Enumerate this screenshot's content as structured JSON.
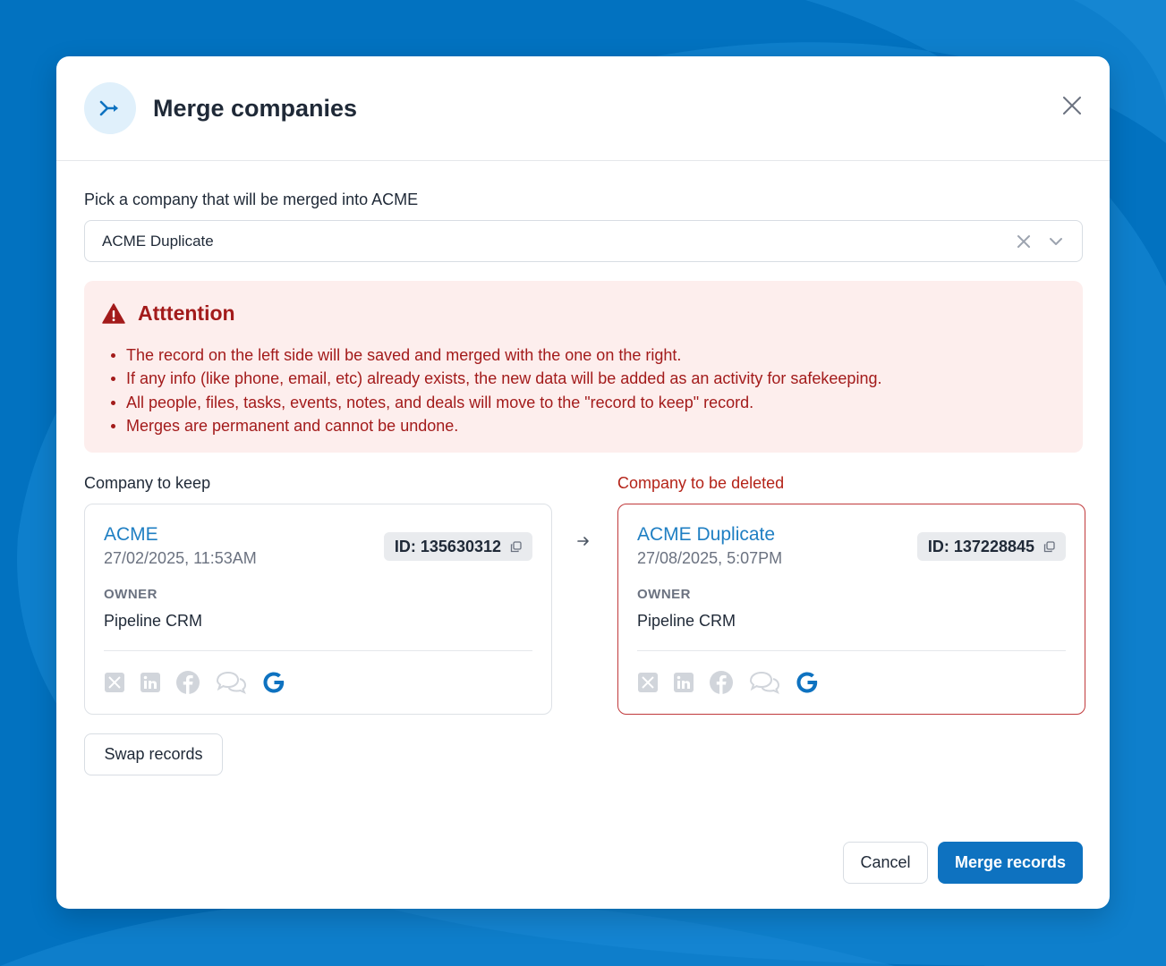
{
  "colors": {
    "background": "#0272c0",
    "accent": "#0e72c0",
    "link": "#1f7fc3",
    "danger": "#a31b1b",
    "alert_bg": "#fdeeed"
  },
  "modal": {
    "title": "Merge companies",
    "header_icon": "merge-arrow-icon",
    "close_icon": "close-icon"
  },
  "picker": {
    "label": "Pick a company that will be merged into ACME",
    "value": "ACME Duplicate"
  },
  "alert": {
    "title": "Atttention",
    "icon": "warning-triangle-icon",
    "items": [
      "The record on the left side will be saved and merged with the one on the right.",
      "If any info (like phone, email, etc) already exists, the new data will be added as an activity for safekeeping.",
      "All people, files, tasks, events, notes, and deals will move to the \"record to keep\" record.",
      "Merges are permanent and cannot be undone."
    ]
  },
  "keep": {
    "heading": "Company to keep",
    "name": "ACME",
    "date": "27/02/2025, 11:53AM",
    "id": "ID: 135630312",
    "owner_label": "OWNER",
    "owner": "Pipeline CRM",
    "socials": [
      "x-icon",
      "linkedin-icon",
      "facebook-icon",
      "chat-icon",
      "google-icon"
    ]
  },
  "delete": {
    "heading": "Company to be deleted",
    "name": "ACME Duplicate",
    "date": "27/08/2025, 5:07PM",
    "id": "ID: 137228845",
    "owner_label": "OWNER",
    "owner": "Pipeline CRM",
    "socials": [
      "x-icon",
      "linkedin-icon",
      "facebook-icon",
      "chat-icon",
      "google-icon"
    ]
  },
  "actions": {
    "swap": "Swap records",
    "cancel": "Cancel",
    "merge": "Merge records"
  }
}
